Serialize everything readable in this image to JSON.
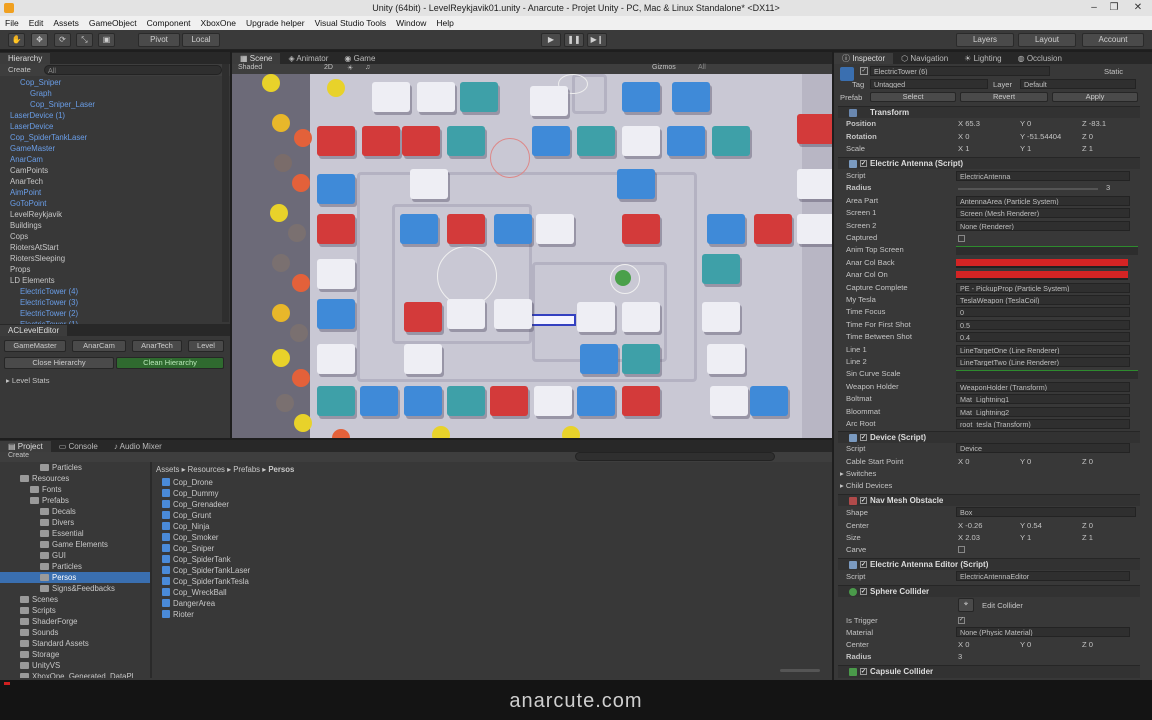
{
  "window": {
    "title": "Unity (64bit) - LevelReykjavik01.unity - Anarcute - Projet Unity - PC, Mac & Linux Standalone* <DX11>",
    "minimize": "–",
    "maximize": "❐",
    "close": "✕"
  },
  "menu": [
    "File",
    "Edit",
    "Assets",
    "GameObject",
    "Component",
    "XboxOne",
    "Upgrade helper",
    "Visual Studio Tools",
    "Window",
    "Help"
  ],
  "toolbar": {
    "pivot": "Pivot",
    "local": "Local",
    "layers": "Layers",
    "layout": "Layout",
    "account": "Account"
  },
  "hierarchy": {
    "tab": "Hierarchy",
    "create": "Create",
    "search": "All",
    "items": [
      {
        "label": "Cop_Sniper",
        "indent": 1,
        "blue": true
      },
      {
        "label": "Graph",
        "indent": 2,
        "blue": true
      },
      {
        "label": "Cop_Sniper_Laser",
        "indent": 2,
        "blue": true
      },
      {
        "label": "LaserDevice (1)",
        "indent": 0,
        "blue": true
      },
      {
        "label": "LaserDevice",
        "indent": 0,
        "blue": true
      },
      {
        "label": "Cop_SpiderTankLaser",
        "indent": 0,
        "blue": true
      },
      {
        "label": "GameMaster",
        "indent": 0,
        "blue": true
      },
      {
        "label": "AnarCam",
        "indent": 0,
        "blue": true
      },
      {
        "label": "CamPoints",
        "indent": 0,
        "blue": false
      },
      {
        "label": "AnarTech",
        "indent": 0,
        "blue": false
      },
      {
        "label": "AimPoint",
        "indent": 0,
        "blue": true
      },
      {
        "label": "GoToPoint",
        "indent": 0,
        "blue": true
      },
      {
        "label": "LevelReykjavik",
        "indent": 0,
        "blue": false
      },
      {
        "label": "Buildings",
        "indent": 0,
        "blue": false
      },
      {
        "label": "Cops",
        "indent": 0,
        "blue": false
      },
      {
        "label": "RiotersAtStart",
        "indent": 0,
        "blue": false
      },
      {
        "label": "RiotersSleeping",
        "indent": 0,
        "blue": false
      },
      {
        "label": "Props",
        "indent": 0,
        "blue": false
      },
      {
        "label": "LD Elements",
        "indent": 0,
        "blue": false
      },
      {
        "label": "ElectricTower (4)",
        "indent": 1,
        "blue": true
      },
      {
        "label": "ElectricTower (3)",
        "indent": 1,
        "blue": true
      },
      {
        "label": "ElectricTower (2)",
        "indent": 1,
        "blue": true
      },
      {
        "label": "ElectricTower (1)",
        "indent": 1,
        "blue": true
      }
    ]
  },
  "aceditor": {
    "tab": "ACLevelEditor",
    "buttons": [
      "GameMaster",
      "AnarCam",
      "AnarTech",
      "Level"
    ],
    "close": "Close Hierarchy",
    "clean": "Clean Hierarchy",
    "stats": "Level Stats"
  },
  "scene": {
    "tabs": [
      "Scene",
      "Animator",
      "Game"
    ],
    "shaded": "Shaded",
    "mode2d": "2D",
    "gizmos": "Gizmos",
    "search": "All"
  },
  "project": {
    "tabs": [
      "Project",
      "Console",
      "Audio Mixer"
    ],
    "create": "Create",
    "breadcrumb": [
      "Assets",
      "Resources",
      "Prefabs",
      "Persos"
    ],
    "tree": [
      {
        "label": "Particles",
        "indent": 2
      },
      {
        "label": "Resources",
        "indent": 0
      },
      {
        "label": "Fonts",
        "indent": 1
      },
      {
        "label": "Prefabs",
        "indent": 1
      },
      {
        "label": "Decals",
        "indent": 2
      },
      {
        "label": "Divers",
        "indent": 2
      },
      {
        "label": "Essential",
        "indent": 2
      },
      {
        "label": "Game Elements",
        "indent": 2
      },
      {
        "label": "GUI",
        "indent": 2
      },
      {
        "label": "Particles",
        "indent": 2
      },
      {
        "label": "Persos",
        "indent": 2,
        "selected": true
      },
      {
        "label": "Signs&Feedbacks",
        "indent": 2
      },
      {
        "label": "Scenes",
        "indent": 0
      },
      {
        "label": "Scripts",
        "indent": 0
      },
      {
        "label": "ShaderForge",
        "indent": 0
      },
      {
        "label": "Sounds",
        "indent": 0
      },
      {
        "label": "Standard Assets",
        "indent": 0
      },
      {
        "label": "Storage",
        "indent": 0
      },
      {
        "label": "UnityVS",
        "indent": 0
      },
      {
        "label": "XboxOne_Generated_DataPl",
        "indent": 0
      }
    ],
    "files": [
      "Cop_Drone",
      "Cop_Dummy",
      "Cop_Grenadeer",
      "Cop_Grunt",
      "Cop_Ninja",
      "Cop_Smoker",
      "Cop_Sniper",
      "Cop_SpiderTank",
      "Cop_SpiderTankLaser",
      "Cop_SpiderTankTesla",
      "Cop_WreckBall",
      "DangerArea",
      "Rioter"
    ]
  },
  "inspector": {
    "tabs": [
      "Inspector",
      "Navigation",
      "Lighting",
      "Occlusion"
    ],
    "object_name": "ElectricTower (6)",
    "static": "Static",
    "tag_label": "Tag",
    "tag": "Untagged",
    "layer_label": "Layer",
    "layer": "Default",
    "prefab_label": "Prefab",
    "select": "Select",
    "revert": "Revert",
    "apply": "Apply",
    "transform": {
      "title": "Transform",
      "position_label": "Position",
      "px": "65.3",
      "py": "0",
      "pz": "-83.1",
      "rotation_label": "Rotation",
      "rx": "0",
      "ry": "-51.54404",
      "rz": "0",
      "scale_label": "Scale",
      "sx": "1",
      "sy": "1",
      "sz": "1"
    },
    "antenna": {
      "title": "Electric Antenna (Script)",
      "rows": [
        {
          "label": "Script",
          "value": "ElectricAntenna"
        },
        {
          "label": "Radius",
          "value": "3"
        },
        {
          "label": "Area Part",
          "value": "AntennaArea (Particle System)"
        },
        {
          "label": "Screen 1",
          "value": "Screen (Mesh Renderer)"
        },
        {
          "label": "Screen 2",
          "value": "None (Renderer)"
        },
        {
          "label": "Captured",
          "value": ""
        },
        {
          "label": "Anim Top Screen",
          "value": ""
        },
        {
          "label": "Anar Col Back",
          "value": ""
        },
        {
          "label": "Anar Col On",
          "value": ""
        },
        {
          "label": "Capture Complete",
          "value": "PE - PickupProp (Particle System)"
        },
        {
          "label": "My Tesla",
          "value": "TeslaWeapon (TeslaCoil)"
        },
        {
          "label": "Time Focus",
          "value": "0"
        },
        {
          "label": "Time For First Shot",
          "value": "0.5"
        },
        {
          "label": "Time Between Shot",
          "value": "0.4"
        },
        {
          "label": "Line 1",
          "value": "LineTargetOne (Line Renderer)"
        },
        {
          "label": "Line 2",
          "value": "LineTargetTwo (Line Renderer)"
        },
        {
          "label": "Sin Curve Scale",
          "value": ""
        },
        {
          "label": "Weapon Holder",
          "value": "WeaponHolder (Transform)"
        },
        {
          "label": "Boltmat",
          "value": "Mat_Lightning1"
        },
        {
          "label": "Bloommat",
          "value": "Mat_Lightning2"
        },
        {
          "label": "Arc Root",
          "value": "root_tesla (Transform)"
        }
      ]
    },
    "device": {
      "title": "Device (Script)",
      "script_label": "Script",
      "script": "Device",
      "cable_label": "Cable Start Point",
      "cx": "0",
      "cy": "0",
      "cz": "0",
      "switches": "Switches",
      "child": "Child Devices"
    },
    "navmesh": {
      "title": "Nav Mesh Obstacle",
      "shape_label": "Shape",
      "shape": "Box",
      "center_label": "Center",
      "cx": "-0.26",
      "cy": "0.54",
      "cz": "0",
      "size_label": "Size",
      "sx": "2.03",
      "sy": "1",
      "sz": "1",
      "carve": "Carve"
    },
    "editor": {
      "title": "Electric Antenna Editor (Script)",
      "script_label": "Script",
      "script": "ElectricAntennaEditor"
    },
    "sphere": {
      "title": "Sphere Collider",
      "edit": "Edit Collider",
      "trigger_label": "Is Trigger",
      "material_label": "Material",
      "material": "None (Physic Material)",
      "center_label": "Center",
      "cx": "0",
      "cy": "0",
      "cz": "0",
      "radius_label": "Radius",
      "radius": "3"
    },
    "capsule": {
      "title": "Capsule Collider"
    }
  },
  "watermark": "anarcute.com",
  "colors": {
    "bg": "#1e1e1e",
    "panel": "#383838",
    "accent": "#3a6fb0",
    "red": "#d42424",
    "green": "#2e8b2e"
  }
}
